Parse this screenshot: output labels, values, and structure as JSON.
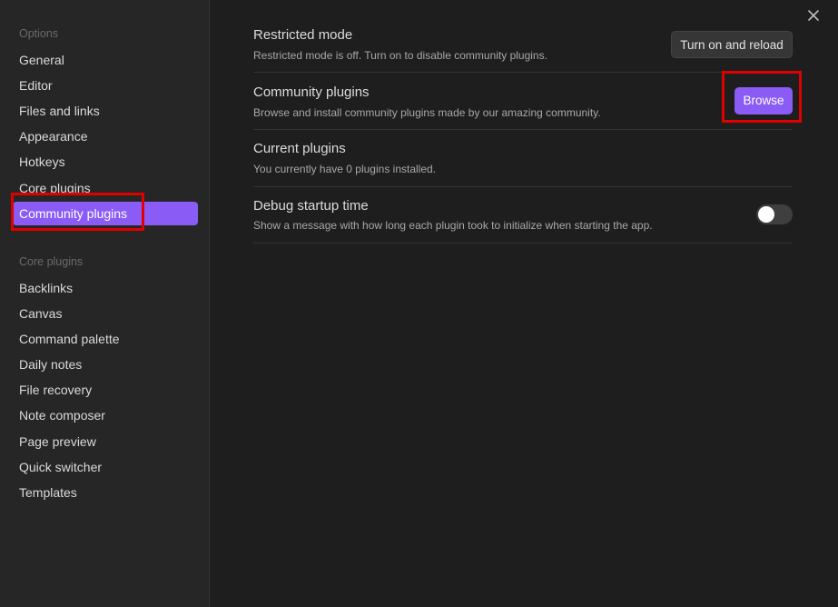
{
  "sidebar": {
    "options_label": "Options",
    "options_items": [
      {
        "label": "General"
      },
      {
        "label": "Editor"
      },
      {
        "label": "Files and links"
      },
      {
        "label": "Appearance"
      },
      {
        "label": "Hotkeys"
      },
      {
        "label": "Core plugins"
      },
      {
        "label": "Community plugins",
        "active": true
      }
    ],
    "core_label": "Core plugins",
    "core_items": [
      {
        "label": "Backlinks"
      },
      {
        "label": "Canvas"
      },
      {
        "label": "Command palette"
      },
      {
        "label": "Daily notes"
      },
      {
        "label": "File recovery"
      },
      {
        "label": "Note composer"
      },
      {
        "label": "Page preview"
      },
      {
        "label": "Quick switcher"
      },
      {
        "label": "Templates"
      }
    ]
  },
  "close_icon": "close-icon",
  "settings": {
    "restricted": {
      "name": "Restricted mode",
      "desc": "Restricted mode is off. Turn on to disable community plugins.",
      "button": "Turn on and reload"
    },
    "community": {
      "name": "Community plugins",
      "desc": "Browse and install community plugins made by our amazing community.",
      "button": "Browse"
    },
    "current": {
      "name": "Current plugins",
      "desc": "You currently have 0 plugins installed."
    },
    "debug": {
      "name": "Debug startup time",
      "desc": "Show a message with how long each plugin took to initialize when starting the app.",
      "enabled": false
    }
  },
  "colors": {
    "accent": "#8a5cf5",
    "highlight": "#e00000"
  }
}
